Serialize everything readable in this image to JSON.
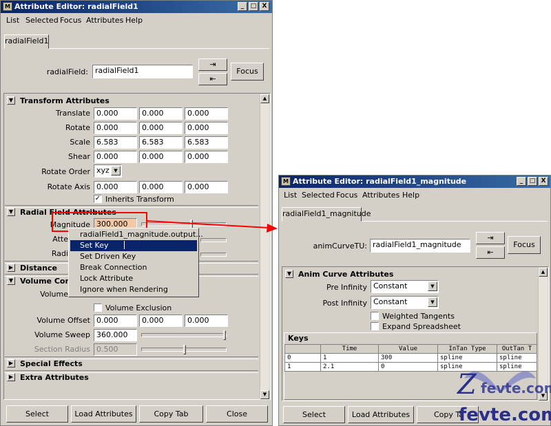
{
  "left_window": {
    "title": "Attribute Editor: radialField1",
    "title_buttons": [
      "_",
      "□",
      "X"
    ],
    "menu": [
      "List",
      "Selected",
      "Focus",
      "Attributes",
      "Help"
    ],
    "tab": "radialField1",
    "node_label": "radialField:",
    "node_value": "radialField1",
    "focus_label": "Focus",
    "transform": {
      "header": "Transform Attributes",
      "translate": {
        "label": "Translate",
        "values": [
          "0.000",
          "0.000",
          "0.000"
        ]
      },
      "rotate": {
        "label": "Rotate",
        "values": [
          "0.000",
          "0.000",
          "0.000"
        ]
      },
      "scale": {
        "label": "Scale",
        "values": [
          "6.583",
          "6.583",
          "6.583"
        ]
      },
      "shear": {
        "label": "Shear",
        "values": [
          "0.000",
          "0.000",
          "0.000"
        ]
      },
      "rotate_order": {
        "label": "Rotate Order",
        "value": "xyz"
      },
      "rotate_axis": {
        "label": "Rotate Axis",
        "values": [
          "0.000",
          "0.000",
          "0.000"
        ]
      },
      "inherits": {
        "label": "Inherits Transform",
        "checked": true
      }
    },
    "radial": {
      "header": "Radial Field Attributes",
      "magnitude_label": "Magnitude",
      "magnitude_value": "300.000",
      "magnitude_slider_level": 0.55,
      "atte_label": "Atte",
      "radi_label": "Radi"
    },
    "distance_header": "Distance",
    "volume": {
      "header": "Volume Cont",
      "volume_label": "Volume",
      "exclusion_label": "Volume Exclusion",
      "offset": {
        "label": "Volume Offset",
        "values": [
          "0.000",
          "0.000",
          "0.000"
        ]
      },
      "sweep": {
        "label": "Volume Sweep",
        "value": "360.000",
        "slider_level": 1.0
      },
      "section": {
        "label": "Section Radius",
        "value": "0.500",
        "slider_level": 0.5
      }
    },
    "special_header": "Special Effects",
    "extra_header": "Extra Attributes",
    "buttons": [
      "Select",
      "Load Attributes",
      "Copy Tab",
      "Close"
    ]
  },
  "context_menu": {
    "items": [
      "radialField1_magnitude.output...",
      "Set Key",
      "Set Driven Key",
      "Break Connection",
      "Lock Attribute",
      "Ignore when Rendering"
    ],
    "selected": "Set Key"
  },
  "right_window": {
    "title": "Attribute Editor: radialField1_magnitude",
    "title_buttons": [
      "_",
      "□",
      "X"
    ],
    "menu": [
      "List",
      "Selected",
      "Focus",
      "Attributes",
      "Help"
    ],
    "tab": "radialField1_magnitude",
    "node_label": "animCurveTU:",
    "node_value": "radialField1_magnitude",
    "focus_label": "Focus",
    "anim": {
      "header": "Anim Curve Attributes",
      "pre_label": "Pre Infinity",
      "pre_value": "Constant",
      "post_label": "Post Infinity",
      "post_value": "Constant",
      "weighted_label": "Weighted Tangents",
      "expand_label": "Expand Spreadsheet"
    },
    "keys": {
      "header": "Keys",
      "columns": [
        "",
        "Time",
        "Value",
        "InTan Type",
        "OutTan T"
      ],
      "rows": [
        [
          "0",
          "1",
          "300",
          "spline",
          "spline"
        ],
        [
          "1",
          "2.1",
          "0",
          "spline",
          "spline"
        ]
      ]
    },
    "buttons": [
      "Select",
      "Load Attributes",
      "Copy Ta"
    ]
  },
  "watermark": {
    "top": "fevte.com",
    "bottom": "fevte.com"
  },
  "colors": {
    "title_bar": "#0a246a",
    "highlight_frame": "#ff0000",
    "selection": "#0a246a",
    "magnitude_field": "#f6c9a6"
  }
}
